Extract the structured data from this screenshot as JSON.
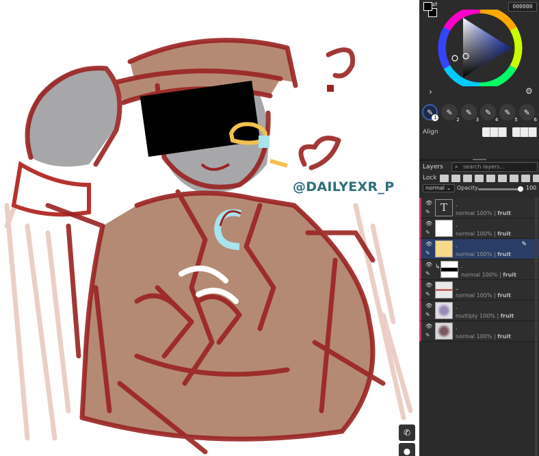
{
  "canvas": {
    "watermark": "@DAILYEXR_P",
    "question_mark": "?",
    "buttons": [
      {
        "icon": "phone-icon"
      },
      {
        "icon": "chat-icon"
      }
    ]
  },
  "color": {
    "hex": "000000",
    "foreground": "#000000",
    "background": "#000000"
  },
  "brushes": [
    {
      "num": "1",
      "active": true
    },
    {
      "num": "2"
    },
    {
      "num": "3"
    },
    {
      "num": "4"
    },
    {
      "num": "5"
    },
    {
      "num": "6"
    }
  ],
  "align": {
    "label": "Align"
  },
  "layers_panel": {
    "title": "Layers",
    "search_placeholder": "search layers...",
    "lock_label": "Lock",
    "blend_mode": "normal",
    "opacity_label": "Opacity",
    "opacity_value": "100"
  },
  "layers": [
    {
      "name": ".",
      "mode": "normal 100% |",
      "group": "fruit",
      "thumb": "T"
    },
    {
      "name": ".",
      "mode": "normal 100% |",
      "group": "fruit",
      "thumb": ""
    },
    {
      "name": ".",
      "mode": "normal 100% |",
      "group": "fruit",
      "thumb": "",
      "selected": true
    },
    {
      "name": ".",
      "mode": "normal 100% |",
      "group": "fruit",
      "thumb": "",
      "clipped": true
    },
    {
      "name": "_",
      "mode": "normal 100% |",
      "group": "fruit",
      "thumb": ""
    },
    {
      "name": ".",
      "mode": "multiply 100% |",
      "group": "fruit",
      "thumb": ""
    },
    {
      "name": ".",
      "mode": "normal 100% |",
      "group": "fruit",
      "thumb": ""
    }
  ]
}
